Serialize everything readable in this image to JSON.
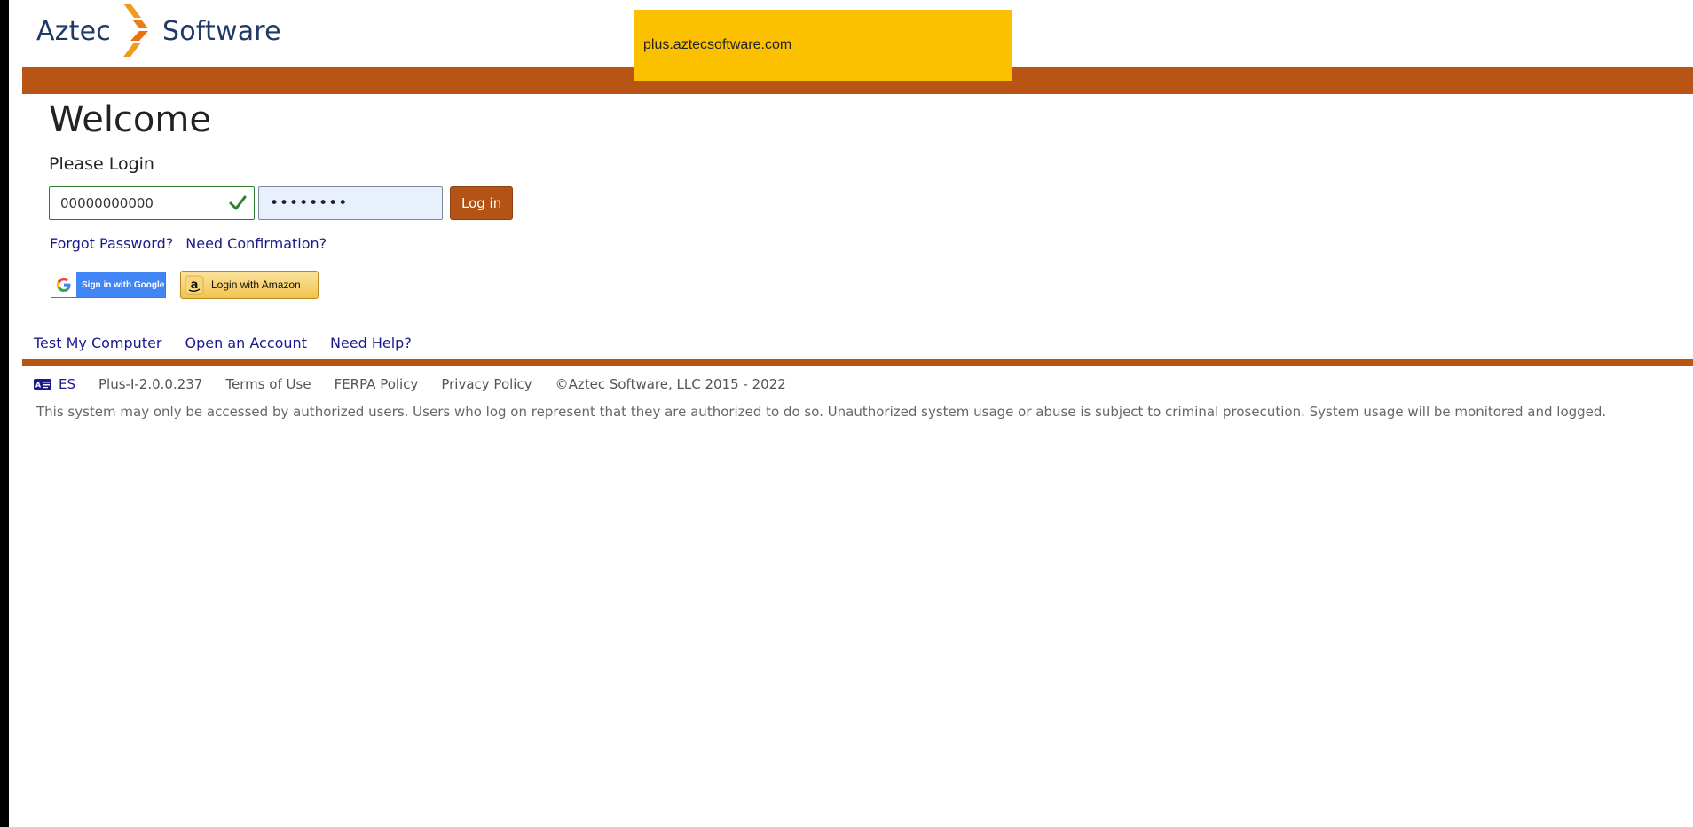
{
  "header": {
    "logo_left": "Aztec",
    "logo_right": "Software",
    "logo_mark_icon": "aztec-chevron-icon",
    "url_banner": "plus.aztecsoftware.com"
  },
  "colors": {
    "accent_bar": "#b85414",
    "banner": "#fbc100",
    "login_button": "#b35315",
    "link": "#1a1a8c",
    "valid_green": "#2e7d32"
  },
  "main": {
    "title": "Welcome",
    "subtitle": "Please Login",
    "username": {
      "value": "00000000000",
      "status_icon": "checkmark-icon"
    },
    "password": {
      "value": "••••••••"
    },
    "login_label": "Log in",
    "forgot_password": "Forgot Password?",
    "need_confirmation": "Need Confirmation?",
    "google_label": "Sign in with Google",
    "amazon_label": "Login with Amazon"
  },
  "footer": {
    "links": [
      "Test My Computer",
      "Open an Account",
      "Need Help?"
    ],
    "language": "ES",
    "language_icon": "language-icon",
    "version": "Plus-I-2.0.0.237",
    "terms": "Terms of Use",
    "ferpa": "FERPA Policy",
    "privacy": "Privacy Policy",
    "copyright": "©Aztec Software, LLC 2015 - 2022",
    "disclaimer": "This system may only be accessed by authorized users. Users who log on represent that they are authorized to do so. Unauthorized system usage or abuse is subject to criminal prosecution. System usage will be monitored and logged."
  }
}
